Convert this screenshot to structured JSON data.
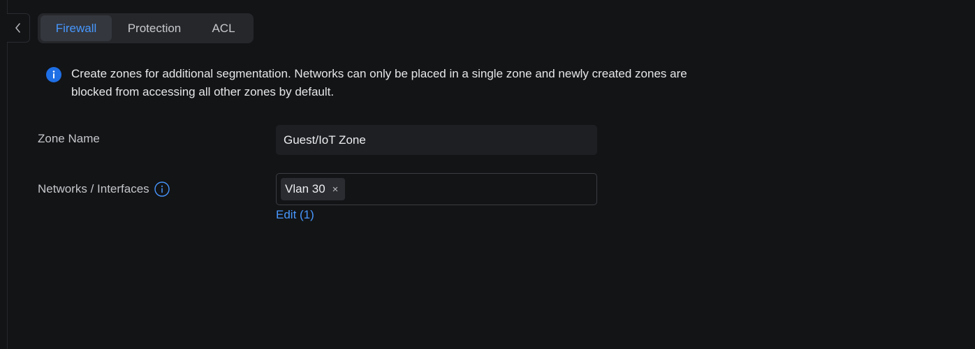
{
  "nav": {
    "back_icon": "chevron-left-icon",
    "tabs": [
      {
        "label": "Firewall",
        "active": true
      },
      {
        "label": "Protection",
        "active": false
      },
      {
        "label": "ACL",
        "active": false
      }
    ]
  },
  "banner": {
    "icon": "info-icon",
    "text": "Create zones for additional segmentation. Networks can only be placed in a single zone and newly created zones are blocked from accessing all other zones by default."
  },
  "form": {
    "zone_name": {
      "label": "Zone Name",
      "value": "Guest/IoT Zone"
    },
    "networks": {
      "label": "Networks / Interfaces",
      "info_icon": "info-outline-icon",
      "chips": [
        {
          "label": "Vlan 30",
          "remove_glyph": "×"
        }
      ],
      "edit_label": "Edit (1)"
    }
  },
  "colors": {
    "background": "#131416",
    "accent": "#4797ff",
    "tab_bar": "#25272b",
    "input_bg": "#1d1f22"
  }
}
